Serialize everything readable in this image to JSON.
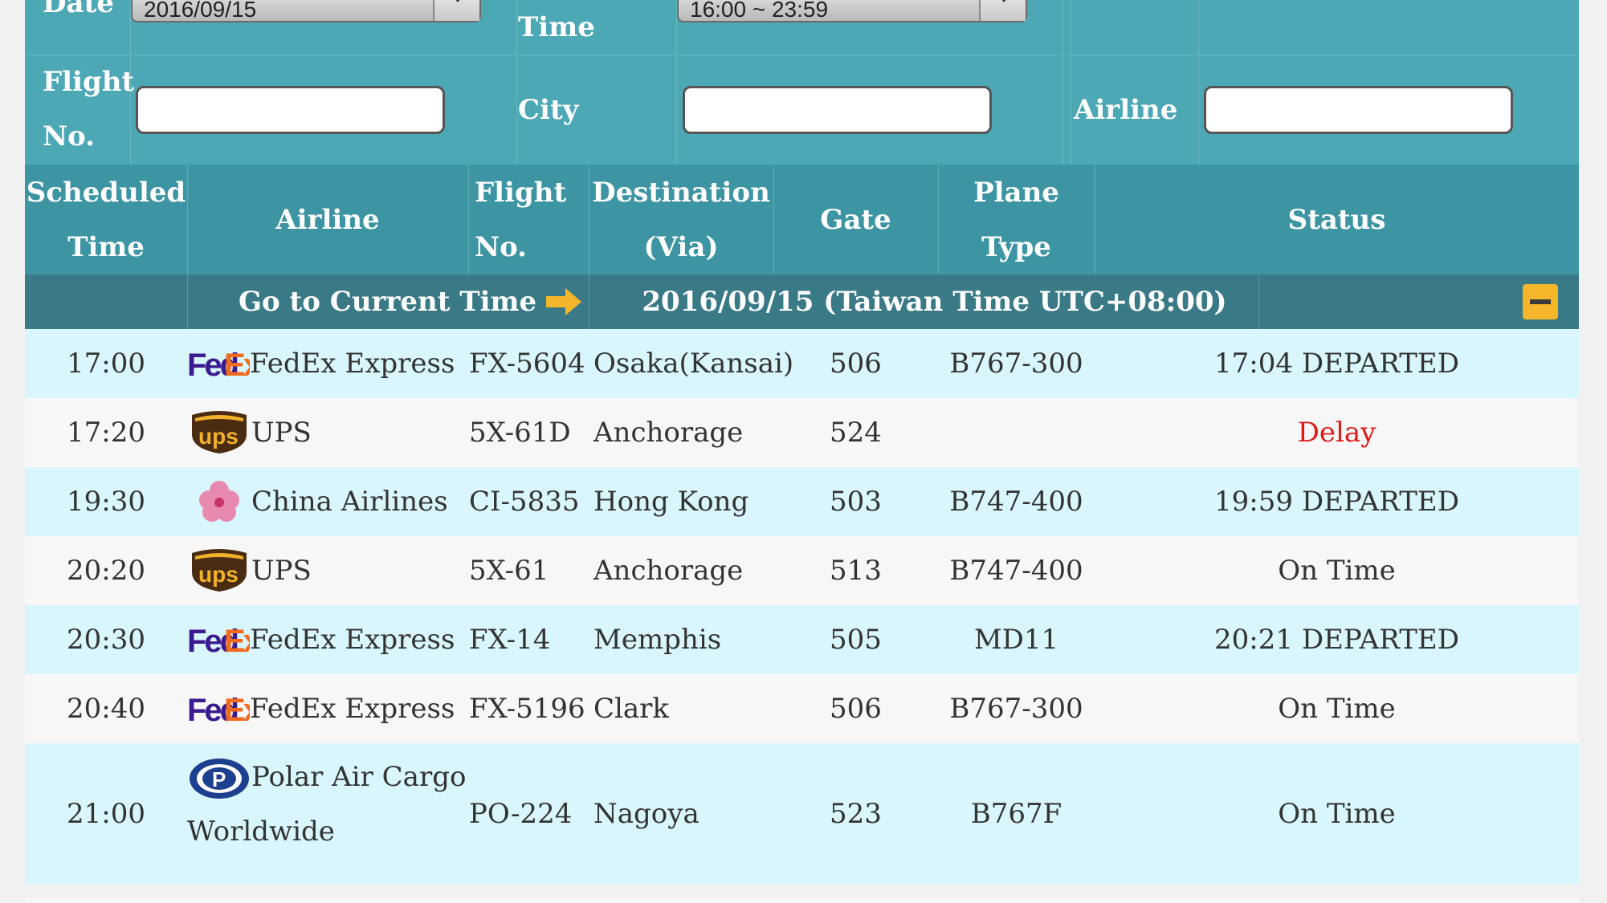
{
  "filters": {
    "date_label": "Date",
    "date_value": "2016/09/15",
    "time_label": "Time",
    "time_value": "16:00 ~ 23:59",
    "flight_label_1": "Flight",
    "flight_label_2": "No.",
    "city_label": "City",
    "airline_label": "Airline",
    "flight_value": "",
    "city_value": "",
    "airline_value": ""
  },
  "columns": {
    "scheduled_1": "Scheduled",
    "scheduled_2": "Time",
    "airline": "Airline",
    "flight_1": "Flight",
    "flight_2": "No.",
    "destination_1": "Destination",
    "destination_2": "(Via)",
    "gate": "Gate",
    "plane_type": "Plane Type",
    "status": "Status"
  },
  "datebar": {
    "go_current": "Go to Current Time",
    "date_text": "2016/09/15 (Taiwan Time UTC+08:00)"
  },
  "colors": {
    "panel": "#4da8b6",
    "header": "#3d95a3",
    "datebar": "#3a7a86",
    "row_odd": "#d8f6fc",
    "row_even": "#f7f7f7",
    "delay": "#e11919"
  },
  "rows": [
    {
      "time": "17:00",
      "logo": "fedex-logo",
      "airline": "FedEx Express",
      "flight": "FX-5604",
      "dest": "Osaka(Kansai)",
      "gate": "506",
      "plane": "B767-300",
      "status": "17:04 DEPARTED"
    },
    {
      "time": "17:20",
      "logo": "ups-logo",
      "airline": "UPS",
      "flight": "5X-61D",
      "dest": "Anchorage",
      "gate": "524",
      "plane": "",
      "status": "Delay"
    },
    {
      "time": "19:30",
      "logo": "china-airlines-logo",
      "airline": "China Airlines",
      "flight": "CI-5835",
      "dest": "Hong Kong",
      "gate": "503",
      "plane": "B747-400",
      "status": "19:59 DEPARTED"
    },
    {
      "time": "20:20",
      "logo": "ups-logo",
      "airline": "UPS",
      "flight": "5X-61",
      "dest": "Anchorage",
      "gate": "513",
      "plane": "B747-400",
      "status": "On Time"
    },
    {
      "time": "20:30",
      "logo": "fedex-logo",
      "airline": "FedEx Express",
      "flight": "FX-14",
      "dest": "Memphis",
      "gate": "505",
      "plane": "MD11",
      "status": "20:21 DEPARTED"
    },
    {
      "time": "20:40",
      "logo": "fedex-logo",
      "airline": "FedEx Express",
      "flight": "FX-5196",
      "dest": "Clark",
      "gate": "506",
      "plane": "B767-300",
      "status": "On Time"
    },
    {
      "time": "21:00",
      "logo": "polar-logo",
      "airline": "Polar Air Cargo Worldwide",
      "flight": "PO-224",
      "dest": "Nagoya",
      "gate": "523",
      "plane": "B767F",
      "status": "On Time"
    }
  ]
}
